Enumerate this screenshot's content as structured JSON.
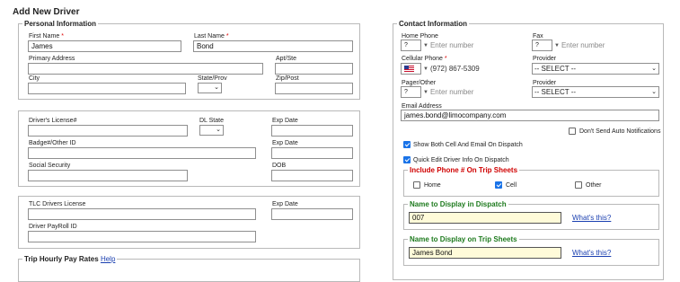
{
  "page": {
    "title": "Add New Driver"
  },
  "personal": {
    "legend": "Personal Information",
    "first_name_label": "First Name",
    "first_name_value": "James",
    "last_name_label": "Last Name",
    "last_name_value": "Bond",
    "primary_address_label": "Primary Address",
    "apt_label": "Apt/Ste",
    "city_label": "City",
    "state_label": "State/Prov",
    "zip_label": "Zip/Post",
    "required_mark": "*"
  },
  "license": {
    "dl_label": "Driver's License#",
    "dl_state_label": "DL State",
    "exp_date_label": "Exp Date",
    "badge_label": "Badge#/Other ID",
    "badge_exp_label": "Exp Date",
    "ssn_label": "Social Security",
    "dob_label": "DOB"
  },
  "tlc": {
    "tlc_label": "TLC Drivers License",
    "tlc_exp_label": "Exp Date",
    "payroll_label": "Driver PayRoll ID"
  },
  "pay": {
    "legend": "Trip Hourly Pay Rates",
    "help_link": "Help"
  },
  "contact": {
    "legend": "Contact Information",
    "home_phone_label": "Home Phone",
    "home_cc": "?",
    "home_placeholder": "Enter number",
    "fax_label": "Fax",
    "fax_cc": "?",
    "fax_placeholder": "Enter number",
    "cell_label": "Cellular Phone",
    "cell_value": "(972) 867-5309",
    "provider_label": "Provider",
    "provider_value": "-- SELECT --",
    "pager_label": "Pager/Other",
    "pager_cc": "?",
    "pager_placeholder": "Enter number",
    "provider2_label": "Provider",
    "provider2_value": "-- SELECT --",
    "email_label": "Email Address",
    "email_value": "james.bond@limocompany.com",
    "no_auto_notify": "Don't Send Auto Notifications",
    "show_both": "Show Both Cell And Email On Dispatch",
    "quick_edit": "Quick Edit Driver Info On Dispatch",
    "required_mark": "*"
  },
  "trip_sheets": {
    "legend": "Include Phone # On Trip Sheets",
    "home": "Home",
    "cell": "Cell",
    "other": "Other",
    "home_checked": false,
    "cell_checked": true,
    "other_checked": false
  },
  "dispatch_name": {
    "legend": "Name to Display in Dispatch",
    "value": "007",
    "whats_this": "What's this?"
  },
  "tripsheet_name": {
    "legend": "Name to Display on Trip Sheets",
    "value": "James Bond",
    "whats_this": "What's this?"
  },
  "colors": {
    "required": "#dd0000",
    "check_accent": "#1a73e8",
    "link": "#1a3fb0",
    "highlight_field": "#fffbd9",
    "red_legend": "#d00000",
    "green_legend": "#1d7a1d"
  }
}
